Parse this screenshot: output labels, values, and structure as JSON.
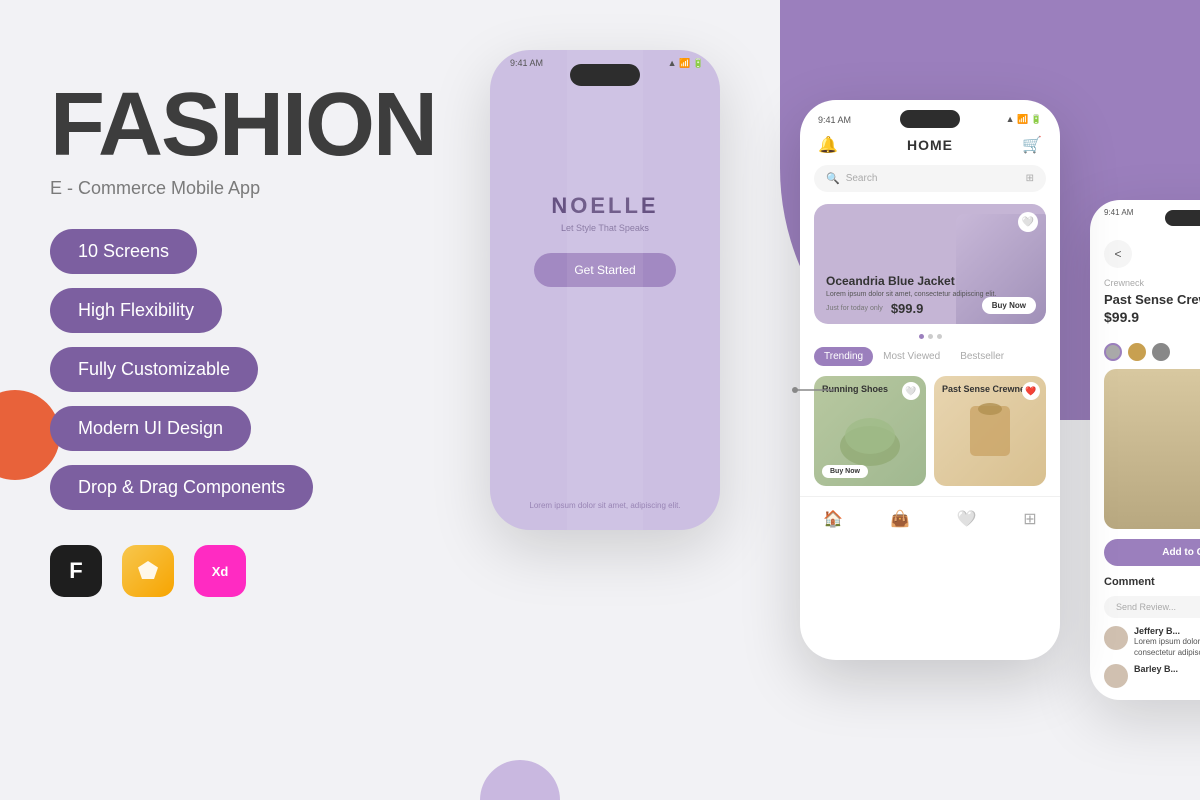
{
  "background": {
    "blob_color": "#9b7fbd",
    "orange_color": "#e8623a"
  },
  "left": {
    "title": "FASHION",
    "subtitle": "E - Commerce Mobile App",
    "badges": [
      "10 Screens",
      "High Flexibility",
      "Fully Customizable",
      "Modern UI Design",
      "Drop & Drag Components"
    ],
    "tools": [
      {
        "name": "Figma",
        "label": "F"
      },
      {
        "name": "Sketch",
        "label": "✏"
      },
      {
        "name": "Adobe XD",
        "label": "Xd"
      }
    ]
  },
  "phone1": {
    "time": "9:41 AM",
    "brand": "NOELLE",
    "tagline": "Let Style That Speaks",
    "cta": "Get Started",
    "footer": "Lorem ipsum dolor sit amet, adipiscing elit."
  },
  "phone2": {
    "time": "9:41 AM",
    "nav_title": "HOME",
    "search_placeholder": "Search",
    "banner": {
      "title": "Oceandria Blue Jacket",
      "description": "Lorem ipsum dolor sit amet, consectetur adipiscing elit.",
      "price_label": "Just for today only",
      "price": "$99.9",
      "cta": "Buy Now"
    },
    "tabs": [
      "Trending",
      "Most Viewed",
      "Bestseller"
    ],
    "products": [
      {
        "name": "Running Shoes",
        "cta": "Buy Now"
      },
      {
        "name": "Past Sense Crewneck",
        "cta": ""
      }
    ]
  },
  "phone3": {
    "time": "9:41 AM",
    "back_label": "<",
    "product_name": "Past Sense Crewneck",
    "category": "Crewneck",
    "price": "$99.9",
    "add_to_cart": "Add to Ca...",
    "comment_section": {
      "title": "Comment",
      "placeholder": "Send Review...",
      "comments": [
        {
          "user": "Jeffery B...",
          "text": "Lorem ipsum dolor sit amet, consectetur adipiscing elit, voluptatem..."
        },
        {
          "user": "Barley B...",
          "text": ""
        }
      ]
    }
  }
}
